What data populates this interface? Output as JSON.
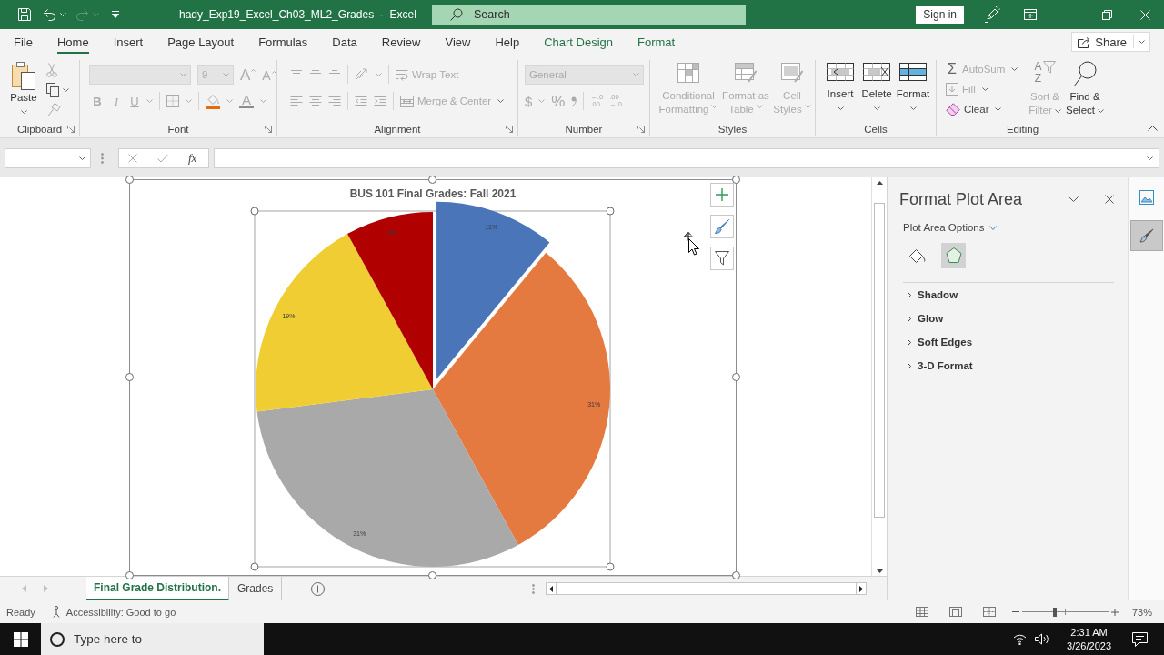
{
  "title_bar": {
    "quick_access": [
      {
        "disabled": false
      },
      {
        "disabled": false
      },
      {
        "disabled": true
      },
      {
        "disabled": false
      }
    ],
    "title": "hady_Exp19_Excel_Ch03_ML2_Grades  -  Excel",
    "search": {
      "placeholder": "Search"
    },
    "sign_in": "Sign in"
  },
  "tabs": [
    {
      "label": "File",
      "selected": false,
      "kind": "standard"
    },
    {
      "label": "Home",
      "selected": true,
      "kind": "standard"
    },
    {
      "label": "Insert",
      "selected": false,
      "kind": "standard"
    },
    {
      "label": "Page Layout",
      "selected": false,
      "kind": "standard"
    },
    {
      "label": "Formulas",
      "selected": false,
      "kind": "standard"
    },
    {
      "label": "Data",
      "selected": false,
      "kind": "standard"
    },
    {
      "label": "Review",
      "selected": false,
      "kind": "standard"
    },
    {
      "label": "View",
      "selected": false,
      "kind": "standard"
    },
    {
      "label": "Help",
      "selected": false,
      "kind": "standard"
    },
    {
      "label": "Chart Design",
      "selected": false,
      "kind": "contextual"
    },
    {
      "label": "Format",
      "selected": false,
      "kind": "contextual"
    }
  ],
  "share": {
    "label": "Share"
  },
  "ribbon": {
    "groups": [
      {
        "label": "Clipboard",
        "items": [
          {
            "label": "Paste",
            "disabled": false
          },
          {
            "disabled": true
          },
          {
            "disabled": false
          },
          {
            "disabled": true
          }
        ]
      },
      {
        "label": "Font",
        "items": [
          {
            "disabled": true
          },
          {
            "value": "9",
            "disabled": true
          },
          {
            "glyph": "A",
            "disabled": true
          },
          {
            "glyph": "A",
            "disabled": true
          },
          {
            "glyph": "B",
            "disabled": true
          },
          {
            "glyph": "I",
            "disabled": true
          },
          {
            "glyph": "U",
            "disabled": true
          },
          {
            "disabled": true
          },
          {
            "color": "#e46c0a",
            "disabled": true
          },
          {
            "glyph": "A",
            "color": "#8c8c8c",
            "disabled": true
          }
        ]
      },
      {
        "label": "Alignment",
        "items": [
          {
            "disabled": true
          },
          {
            "disabled": true
          },
          {
            "disabled": true
          },
          {
            "disabled": true
          },
          {
            "label": "Wrap Text",
            "disabled": true
          },
          {
            "disabled": true
          },
          {
            "disabled": true
          },
          {
            "disabled": true
          },
          {
            "disabled": true
          },
          {
            "disabled": true
          },
          {
            "label": "Merge & Center",
            "disabled": true
          }
        ]
      },
      {
        "label": "Number",
        "items": [
          {
            "value": "General",
            "disabled": true
          },
          {
            "glyph": "$",
            "disabled": true
          },
          {
            "glyph": "%",
            "disabled": true
          },
          {
            "disabled": true
          },
          {
            "glyph_lines": [
              "←.0",
              ".00"
            ],
            "disabled": true
          },
          {
            "glyph_lines": [
              ".00",
              "→.0"
            ],
            "disabled": true
          }
        ]
      },
      {
        "label": "Styles",
        "items": [
          {
            "label": "Conditional Formatting",
            "disabled": true
          },
          {
            "label": "Format as Table",
            "disabled": true
          },
          {
            "label": "Cell Styles",
            "disabled": true
          }
        ]
      },
      {
        "label": "Cells",
        "items": [
          {
            "label": "Insert",
            "disabled": false
          },
          {
            "label": "Delete",
            "disabled": false
          },
          {
            "label": "Format",
            "disabled": false
          }
        ]
      },
      {
        "label": "Editing",
        "items": [
          {
            "glyph": "Σ",
            "label": "AutoSum",
            "disabled": true
          },
          {
            "label": "Fill",
            "disabled": true
          },
          {
            "label": "Clear",
            "disabled": false
          },
          {
            "glyph_lines": [
              "A",
              "Z"
            ],
            "label": "Sort & Filter",
            "disabled": true
          },
          {
            "label": "Find & Select",
            "disabled": false
          }
        ]
      }
    ]
  },
  "formula_bar": {
    "buttons": [
      {
        "disabled": true
      },
      {
        "disabled": true
      },
      {
        "glyph": "fx",
        "disabled": false
      }
    ]
  },
  "chart": {
    "selected": true,
    "plot_area_selected": true,
    "chart_data": {
      "type": "pie",
      "title": "BUS 101 Final Grades: Fall 2021",
      "values": [
        11,
        31,
        31,
        19,
        8
      ],
      "value_labels": [
        "11%",
        "31%",
        "31%",
        "19%",
        "8%"
      ],
      "colors": [
        "#4a75b9",
        "#e57a41",
        "#a9a9a9",
        "#f0cd32",
        "#b00000"
      ]
    }
  },
  "format_pane": {
    "title": "Format Plot Area",
    "options_label": "Plot Area Options",
    "option_tabs": [
      {
        "selected": false
      },
      {
        "selected": true
      }
    ],
    "sections": [
      {
        "label": "Shadow",
        "expanded": false
      },
      {
        "label": "Glow",
        "expanded": false
      },
      {
        "label": "Soft Edges",
        "expanded": false
      },
      {
        "label": "3-D Format",
        "expanded": false
      }
    ]
  },
  "side_tabs": [
    {
      "selected": false
    },
    {
      "selected": true
    }
  ],
  "sheet_tabs": [
    {
      "label": "Final Grade Distribution.",
      "selected": true
    },
    {
      "label": "Grades",
      "selected": false
    }
  ],
  "status_bar": {
    "mode": "Ready",
    "accessibility": "Accessibility: Good to go",
    "zoom": {
      "level": 0.38,
      "reading": "73%"
    }
  },
  "taskbar": {
    "search": {
      "placeholder": "Type here to"
    },
    "time": "2:31 AM",
    "date": "3/26/2023"
  }
}
